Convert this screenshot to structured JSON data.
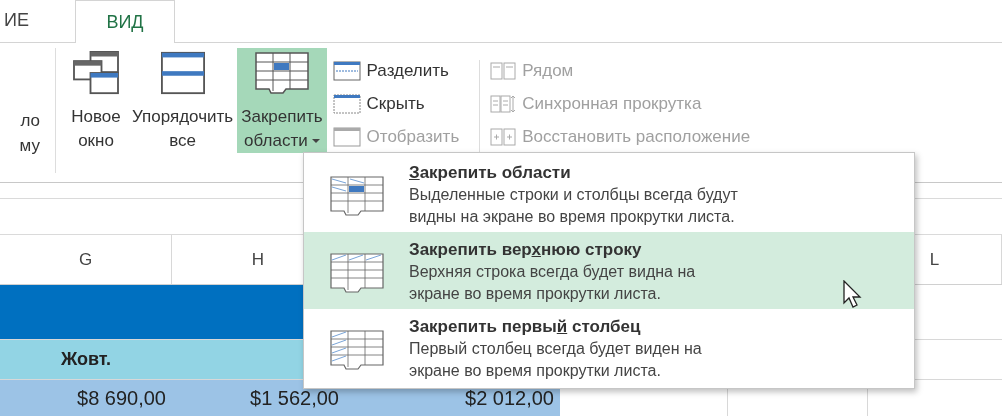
{
  "tabs": [
    {
      "label": "ИЕ",
      "selected": false
    },
    {
      "label": "ВИД",
      "selected": true
    }
  ],
  "ribbon": {
    "cut_label": [
      "ло",
      "му"
    ],
    "large_buttons": [
      {
        "kind": "new-window",
        "lines": [
          "Новое",
          "окно"
        ],
        "highlighted": false,
        "dropdown": false
      },
      {
        "kind": "arrange",
        "lines": [
          "Упорядочить",
          "все"
        ],
        "highlighted": false,
        "dropdown": false
      },
      {
        "kind": "freeze",
        "lines": [
          "Закрепить",
          "области"
        ],
        "highlighted": true,
        "dropdown": true
      }
    ],
    "small_buttons": [
      {
        "kind": "split",
        "label": "Разделить",
        "disabled": false
      },
      {
        "kind": "hide",
        "label": "Скрыть",
        "disabled": false
      },
      {
        "kind": "unhide",
        "label": "Отобразить",
        "disabled": true
      }
    ],
    "compare_buttons": [
      {
        "kind": "side-by-side",
        "label": "Рядом",
        "disabled": true
      },
      {
        "kind": "sync-scroll",
        "label": "Синхронная прокрутка",
        "disabled": true
      },
      {
        "kind": "reset-position",
        "label": "Восстановить расположение",
        "disabled": true
      }
    ]
  },
  "sheet": {
    "columns": [
      {
        "label": "G"
      },
      {
        "label": "H"
      }
    ],
    "right_columns": [
      {
        "label": "L"
      }
    ],
    "header_cells": [
      "Жовт."
    ],
    "values": [
      "$8 690,00",
      "$1 562,00",
      "$2 012,00"
    ]
  },
  "menu": {
    "items": [
      {
        "kind": "panes",
        "access_key": "З",
        "title_after": "акрепить области",
        "description": [
          "Выделенные строки и столбцы всегда будут",
          "видны на экране во время прокрутки листа."
        ],
        "selected": false
      },
      {
        "kind": "top-row",
        "title_before": "Закрепить вер",
        "access_key": "х",
        "title_after": "нюю строку",
        "description": [
          "Верхняя строка всегда будет видна на",
          "экране во время прокрутки листа."
        ],
        "selected": true
      },
      {
        "kind": "first-column",
        "title_before": "Закрепить первы",
        "access_key": "й",
        "title_after": " столбец",
        "description": [
          "Первый столбец всегда будет виден на",
          "экране во время прокрутки листа."
        ],
        "selected": false
      }
    ]
  }
}
